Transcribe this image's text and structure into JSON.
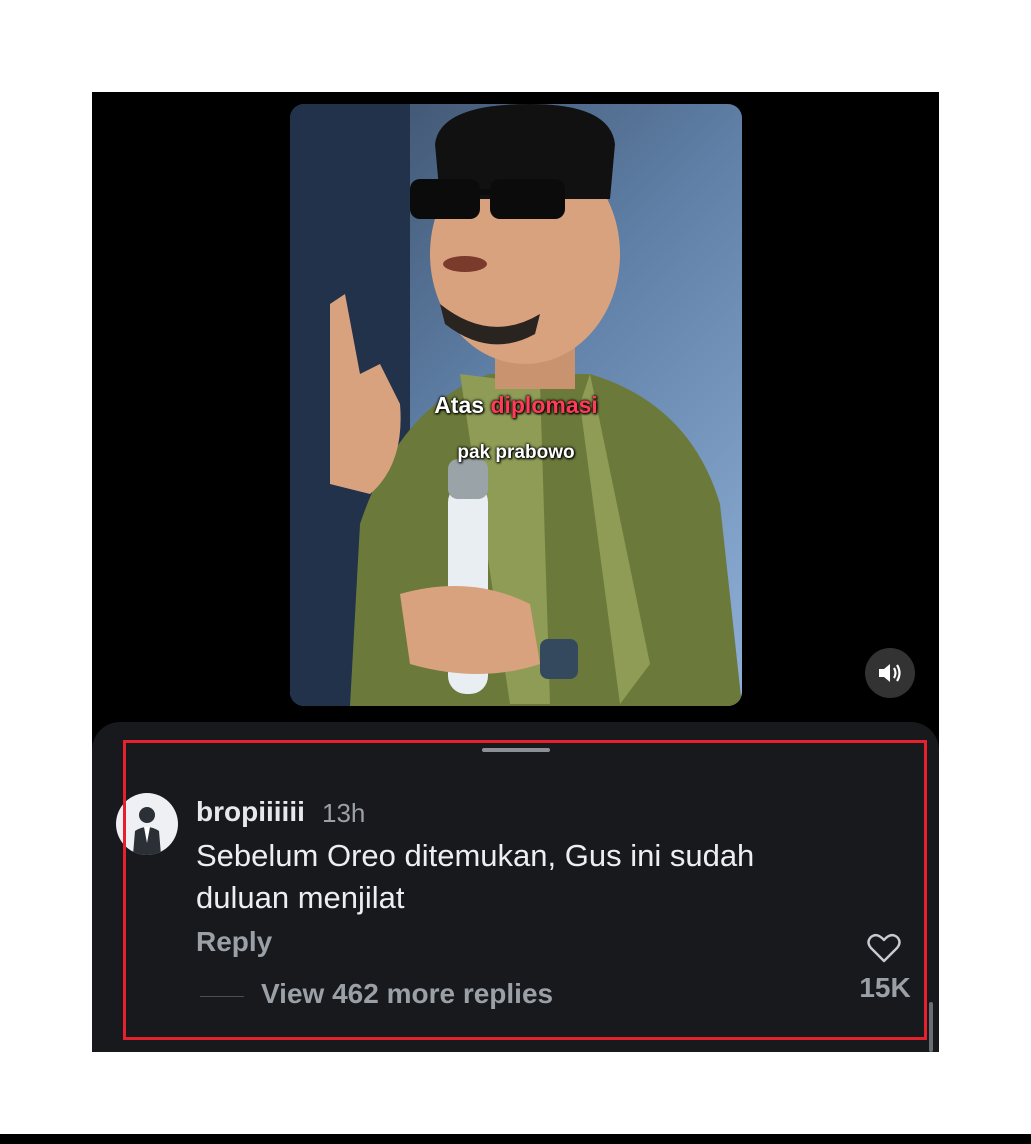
{
  "video": {
    "caption_word1": "Atas ",
    "caption_highlight": "diplomasi",
    "caption_line2": "pak prabowo",
    "volume_icon": "speaker-volume-icon"
  },
  "comment": {
    "username": "bropiiiiii",
    "time": "13h",
    "text": "Sebelum Oreo ditemukan, Gus ini sudah duluan menjilat",
    "reply_label": "Reply",
    "view_replies_label": "View 462 more replies",
    "like_count": "15K",
    "like_icon": "heart-outline-icon"
  },
  "colors": {
    "highlight_border": "#e5212e",
    "caption_accent": "#ff3b57",
    "sheet_background": "#17191d"
  }
}
